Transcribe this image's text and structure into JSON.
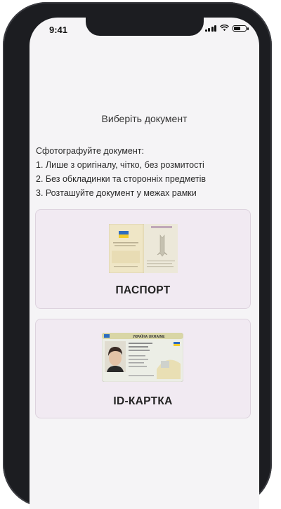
{
  "status_bar": {
    "time": "9:41",
    "battery_level": 0.6
  },
  "screen": {
    "title": "Виберіть документ",
    "instructions": [
      "Сфотографуйте документ:",
      "1. Лише з оригіналу, чітко, без розмитості",
      "2. Без обкладинки та сторонніх предметів",
      "3. Розташуйте документ у межах рамки"
    ]
  },
  "documents": [
    {
      "label": "ПАСПОРТ",
      "image": "ukrainian-passport-image"
    },
    {
      "label": "ID-КАРТКА",
      "image": "ukrainian-id-card-image",
      "card_header": "УКРАЇНА UKRAINE"
    }
  ],
  "colors": {
    "card_background": "#f1eaf2",
    "card_border": "#ddd3de",
    "phone_frame": "#1c1d21",
    "flag_blue": "#2d6cc0",
    "flag_yellow": "#f2cc2c"
  }
}
